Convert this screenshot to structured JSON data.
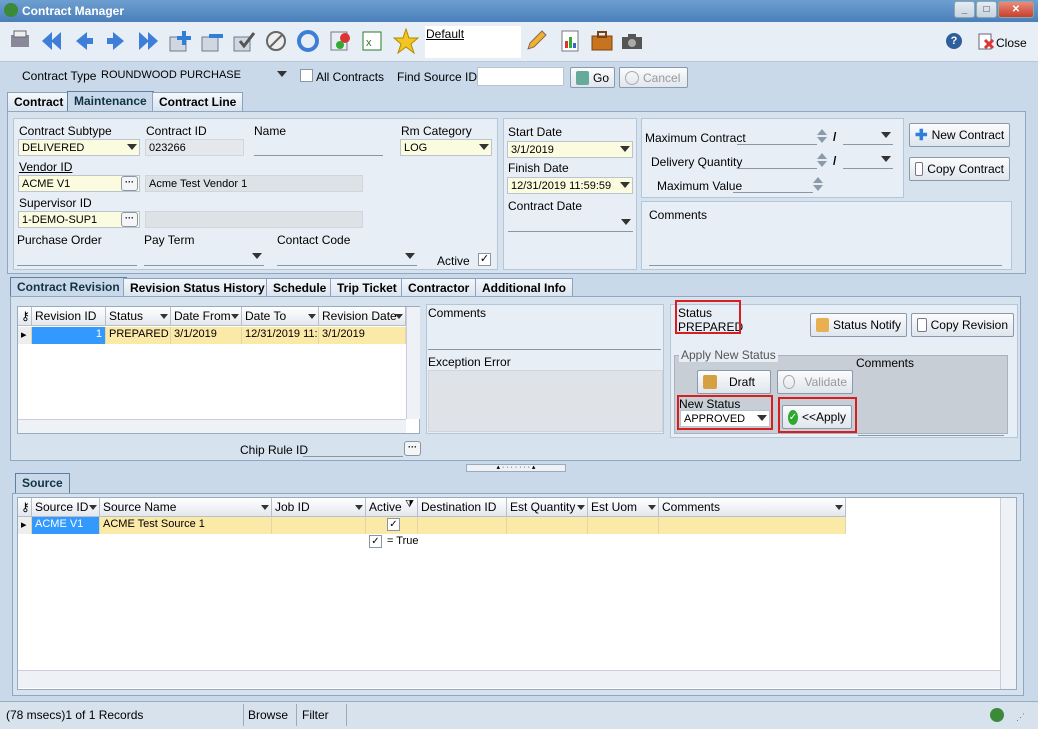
{
  "window": {
    "title": "Contract Manager",
    "min": "_",
    "max": "□",
    "close": "✕"
  },
  "toolbar": {
    "layout_name": "Default",
    "close_label": "Close",
    "help": "?"
  },
  "filter": {
    "contract_type_label": "Contract Type",
    "contract_type_value": "ROUNDWOOD PURCHASE",
    "all_contracts_label": "All Contracts",
    "find_source_label": "Find Source ID:",
    "find_source_value": "",
    "go_label": "Go",
    "cancel_label": "Cancel"
  },
  "main_tabs": [
    {
      "label": "Contract"
    },
    {
      "label": "Maintenance"
    },
    {
      "label": "Contract Line"
    }
  ],
  "form": {
    "contract_subtype_label": "Contract Subtype",
    "contract_subtype_value": "DELIVERED",
    "contract_id_label": "Contract ID",
    "contract_id_value": "023266",
    "name_label": "Name",
    "name_value": "",
    "rm_category_label": "Rm Category",
    "rm_category_value": "LOG",
    "vendor_id_label": "Vendor ID",
    "vendor_id_value": "ACME V1",
    "vendor_name": "Acme Test Vendor 1",
    "supervisor_id_label": "Supervisor ID",
    "supervisor_id_value": "1-DEMO-SUP1",
    "supervisor_name": "",
    "purchase_order_label": "Purchase Order",
    "pay_term_label": "Pay Term",
    "contact_code_label": "Contact Code",
    "active_label": "Active",
    "start_date_label": "Start Date",
    "start_date_value": "3/1/2019",
    "finish_date_label": "Finish Date",
    "finish_date_value": "12/31/2019 11:59:59",
    "contract_date_label": "Contract Date",
    "contract_date_value": "",
    "max_contract_label": "Maximum Contract",
    "delivery_qty_label": "Delivery Quantity",
    "max_value_label": "Maximum Value",
    "slash": "/",
    "comments_label": "Comments",
    "new_contract_label": "New Contract",
    "copy_contract_label": "Copy Contract"
  },
  "sub_tabs": [
    {
      "label": "Contract Revision"
    },
    {
      "label": "Revision Status History"
    },
    {
      "label": "Schedule"
    },
    {
      "label": "Trip Ticket"
    },
    {
      "label": "Contractor"
    },
    {
      "label": "Additional Info"
    }
  ],
  "revision_grid": {
    "columns": [
      "Revision ID",
      "Status",
      "Date From",
      "Date To",
      "Revision Date"
    ],
    "rows": [
      {
        "revision_id": "1",
        "status": "PREPARED",
        "date_from": "3/1/2019",
        "date_to": "12/31/2019 11:",
        "revision_date": "3/1/2019"
      }
    ]
  },
  "revision_side": {
    "comments_label": "Comments",
    "exception_label": "Exception Error",
    "chip_rule_label": "Chip Rule ID"
  },
  "status_area": {
    "status_label": "Status",
    "status_value": "PREPARED",
    "status_notify_label": "Status Notify",
    "copy_revision_label": "Copy Revision",
    "apply_group_label": "Apply New Status",
    "comments_label": "Comments",
    "draft_label": "Draft",
    "validate_label": "Validate",
    "new_status_label": "New Status",
    "new_status_value": "APPROVED",
    "apply_label": "<<Apply"
  },
  "source_tab": {
    "label": "Source"
  },
  "source_grid": {
    "columns": [
      "Source ID",
      "Source Name",
      "Job ID",
      "Active",
      "Destination ID",
      "Est Quantity",
      "Est Uom",
      "Comments"
    ],
    "rows": [
      {
        "source_id": "ACME V1",
        "source_name": "ACME Test Source 1",
        "job_id": "",
        "active": "✓",
        "destination_id": "",
        "est_quantity": "",
        "est_uom": "",
        "comments": ""
      }
    ],
    "filter_text": "= True"
  },
  "statusbar": {
    "records": "(78 msecs)1 of 1 Records",
    "mode": "Browse",
    "filter": "Filter"
  },
  "colors": {
    "title": "#4a7fba",
    "highlight": "#d81e1e",
    "row": "#fbe9a8",
    "selected": "#3399ff"
  }
}
